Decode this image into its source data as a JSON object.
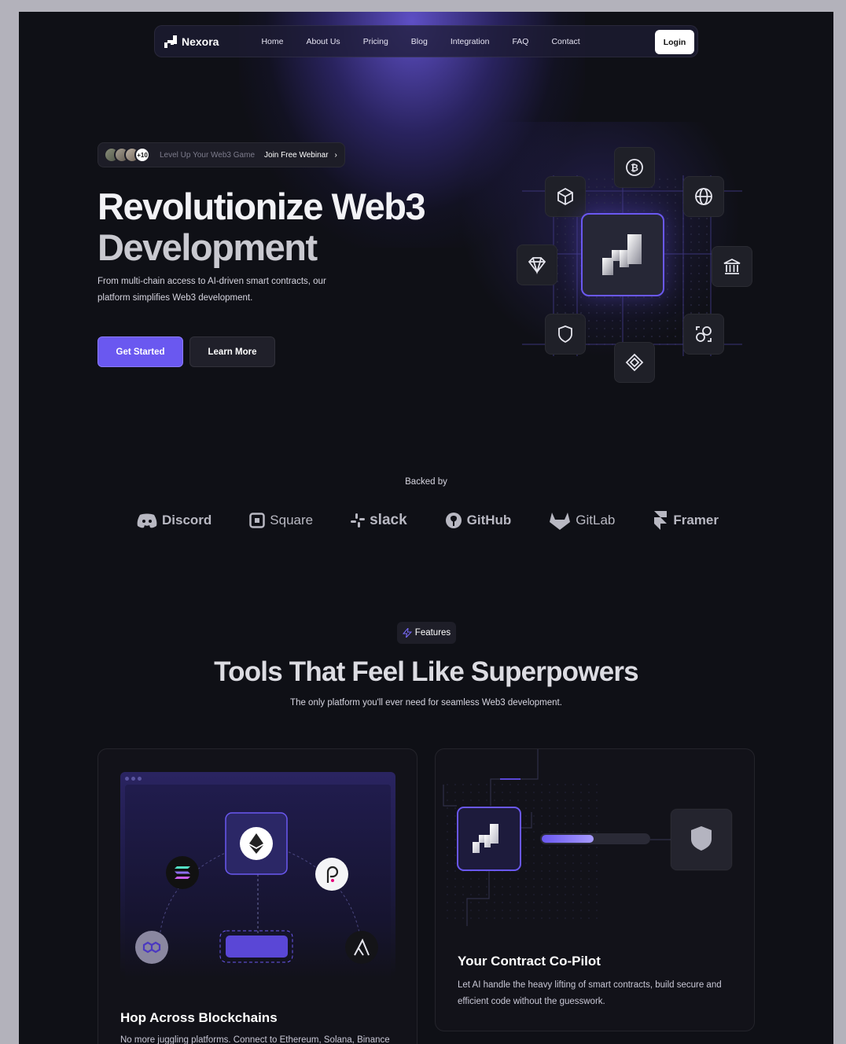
{
  "nav": {
    "brand": "Nexora",
    "links": [
      "Home",
      "About Us",
      "Pricing",
      "Blog",
      "Integration",
      "FAQ",
      "Contact"
    ],
    "login": "Login"
  },
  "hero": {
    "badge_count": "+10",
    "badge_text": "Level Up Your Web3 Game",
    "badge_link": "Join Free Webinar",
    "title_line1": "Revolutionize Web3",
    "title_line2": "Development",
    "subtitle": "From multi-chain access to AI-driven smart contracts, our platform simplifies Web3 development.",
    "primary_cta": "Get Started",
    "secondary_cta": "Learn More",
    "diagram_icons": [
      "bitcoin-icon",
      "cube-icon",
      "globe-icon",
      "diamond-icon",
      "bank-icon",
      "shield-icon",
      "swap-icon",
      "chain-link-icon"
    ]
  },
  "backed": {
    "label": "Backed by",
    "brands": [
      "Discord",
      "Square",
      "slack",
      "GitHub",
      "GitLab",
      "Framer"
    ]
  },
  "features": {
    "badge": "Features",
    "title": "Tools That Feel Like Superpowers",
    "subtitle": "The only platform you'll ever need for seamless Web3 development.",
    "cards": [
      {
        "title": "Hop Across Blockchains",
        "description": "No more juggling platforms. Connect to Ethereum, Solana, Binance"
      },
      {
        "title": "Your Contract Co-Pilot",
        "description": "Let AI handle the heavy lifting of smart contracts, build secure and efficient code without the guesswork."
      }
    ]
  },
  "colors": {
    "accent": "#6a58f0",
    "background": "#0f1016"
  }
}
